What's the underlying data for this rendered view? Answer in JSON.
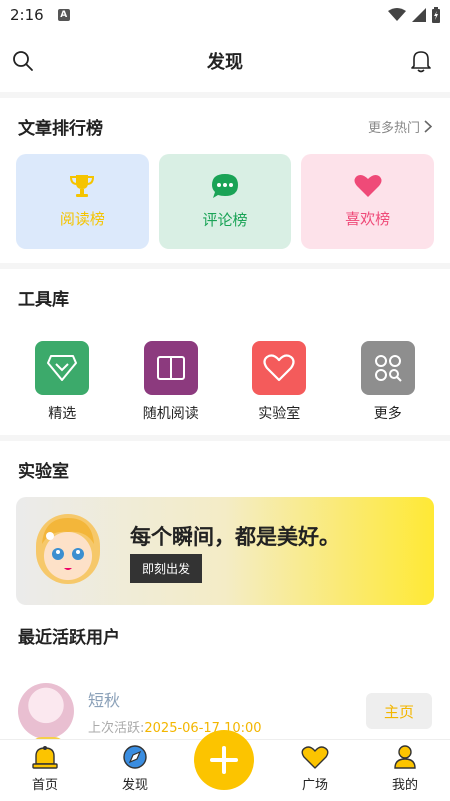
{
  "status_bar": {
    "time": "2:16",
    "notification_letter": "A"
  },
  "header": {
    "title": "发现"
  },
  "rank_section": {
    "title": "文章排行榜",
    "more": "更多热门",
    "cards": [
      {
        "label": "阅读榜",
        "icon": "trophy-icon",
        "color": "#f5c400"
      },
      {
        "label": "评论榜",
        "icon": "comment-icon",
        "color": "#1aa356"
      },
      {
        "label": "喜欢榜",
        "icon": "heart-icon",
        "color": "#ef4a78"
      }
    ]
  },
  "tools_section": {
    "title": "工具库",
    "items": [
      {
        "label": "精选",
        "icon": "diamond-icon",
        "color": "#3caa6b"
      },
      {
        "label": "随机阅读",
        "icon": "book-icon",
        "color": "#8c3a7e"
      },
      {
        "label": "实验室",
        "icon": "heart-outline-icon",
        "color": "#f45b5b"
      },
      {
        "label": "更多",
        "icon": "more-grid-icon",
        "color": "#8e8e8e"
      }
    ]
  },
  "lab_section": {
    "title": "实验室",
    "slogan": "每个瞬间，都是美好。",
    "button": "即刻出发"
  },
  "users_section": {
    "title": "最近活跃用户",
    "users": [
      {
        "name": "短秋",
        "last_prefix": "上次活跃:",
        "last_time": "2025-06-17 10:00",
        "button": "主页"
      }
    ]
  },
  "bottom_nav": {
    "items": [
      {
        "label": "首页",
        "icon": "bell-home-icon"
      },
      {
        "label": "发现",
        "icon": "compass-icon"
      },
      {
        "label": "广场",
        "icon": "heart-square-icon"
      },
      {
        "label": "我的",
        "icon": "user-icon"
      }
    ],
    "fab_icon": "plus-icon",
    "accent": "#fcc400"
  }
}
